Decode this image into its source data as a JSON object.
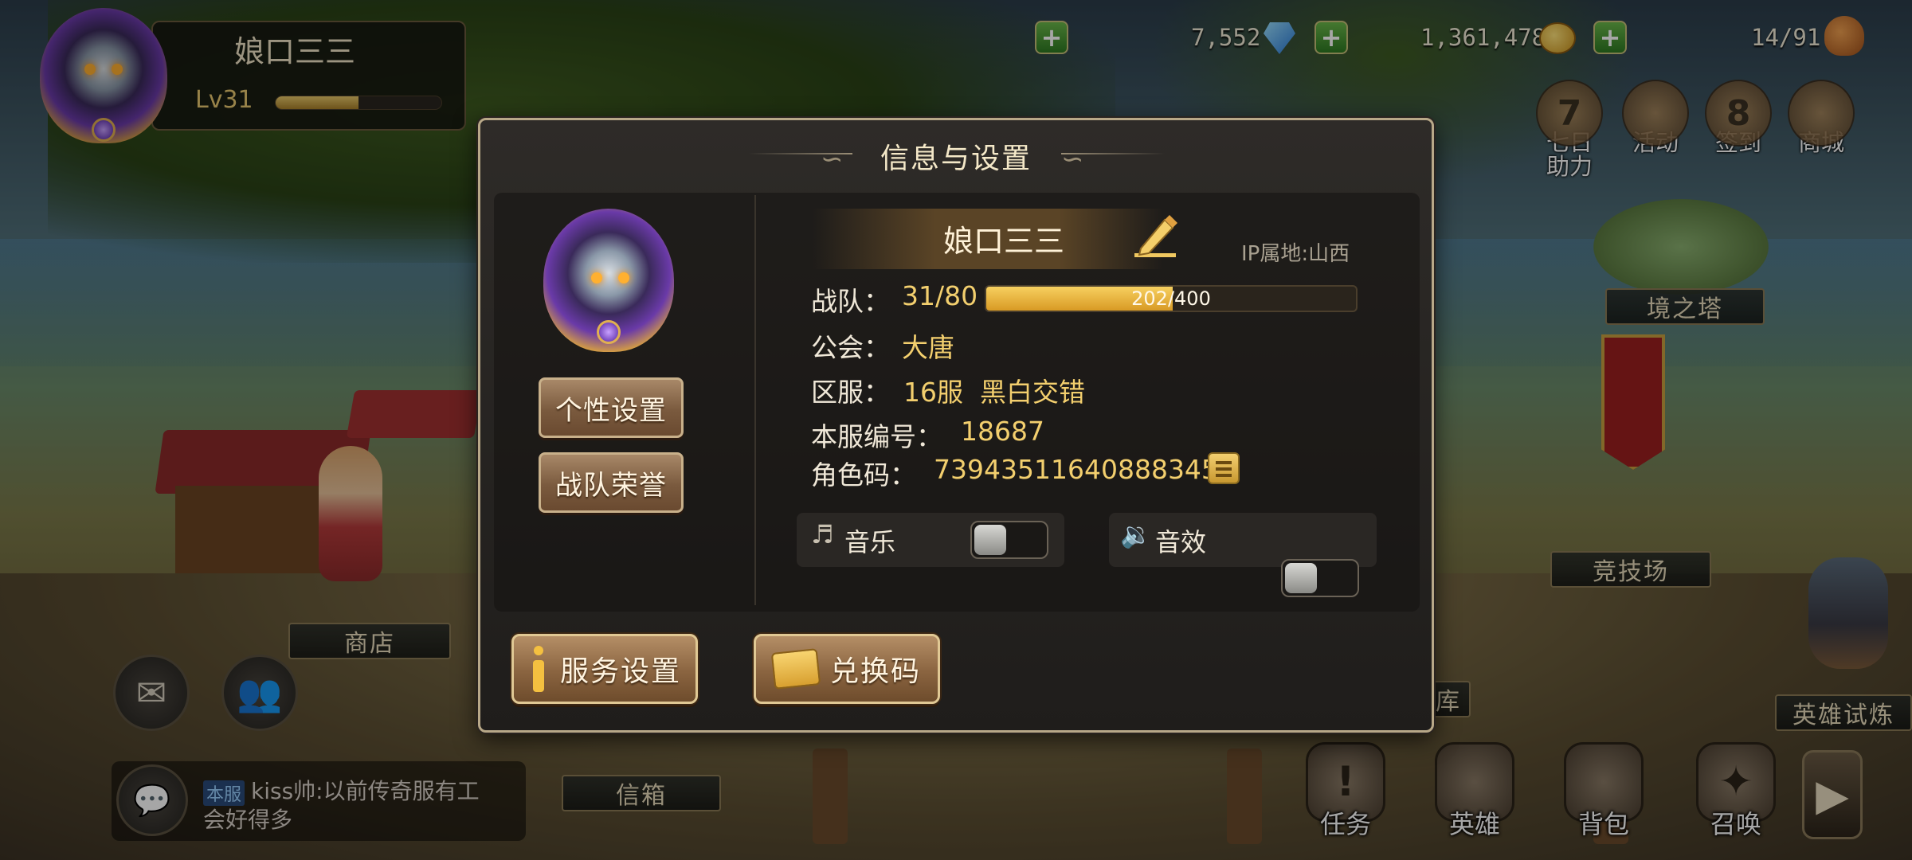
{
  "player": {
    "name": "娘口三三",
    "level": "Lv31",
    "level_progress": 0.5
  },
  "resources": {
    "diamonds": "7,552",
    "gold": "1,361,478",
    "stamina": "14/91"
  },
  "shortcuts": [
    {
      "label": "七日助力",
      "icon": "seven-day-icon",
      "glyph": "7"
    },
    {
      "label": "活动",
      "icon": "event-chest-icon",
      "glyph": ""
    },
    {
      "label": "签到",
      "icon": "calendar-icon",
      "glyph": "8"
    },
    {
      "label": "商城",
      "icon": "money-bag-icon",
      "glyph": ""
    }
  ],
  "map_labels": {
    "tower": "境之塔",
    "arena": "竞技场",
    "shop": "商店",
    "mailbox": "信箱",
    "hero_trial": "英雄试炼",
    "partial": "库"
  },
  "chat": {
    "tag": "本服",
    "message": "kiss帅:以前传奇服有工会好得多"
  },
  "bottom_nav": [
    {
      "label": "任务",
      "icon": "quest-scroll-icon",
      "glyph": "!"
    },
    {
      "label": "英雄",
      "icon": "helmet-icon",
      "glyph": ""
    },
    {
      "label": "背包",
      "icon": "backpack-icon",
      "glyph": ""
    },
    {
      "label": "召唤",
      "icon": "summon-icon",
      "glyph": "✦"
    }
  ],
  "modal": {
    "title": "信息与设置",
    "player_name": "娘口三三",
    "ip_location": "IP属地:山西",
    "buttons": {
      "personal_settings": "个性设置",
      "team_honor": "战队荣誉",
      "service_settings": "服务设置",
      "redeem_code": "兑换码"
    },
    "info": {
      "team_label": "战队：",
      "team_value": "31/80",
      "exp_text": "202/400",
      "exp_progress": 0.505,
      "guild_label": "公会：",
      "guild_value": "大唐",
      "server_label": "区服：",
      "server_value": "16服  黑白交错",
      "server_no_label": "本服编号：",
      "server_no_value": "18687",
      "role_code_label": "角色码：",
      "role_code_value": "739435116408883455"
    },
    "toggles": {
      "music_label": "音乐",
      "music_on": false,
      "sfx_label": "音效",
      "sfx_on": false
    }
  },
  "colors": {
    "accent_gold": "#f3cf6e",
    "exp_fill": "#e8b23a",
    "button_brown": "#8a6440"
  }
}
